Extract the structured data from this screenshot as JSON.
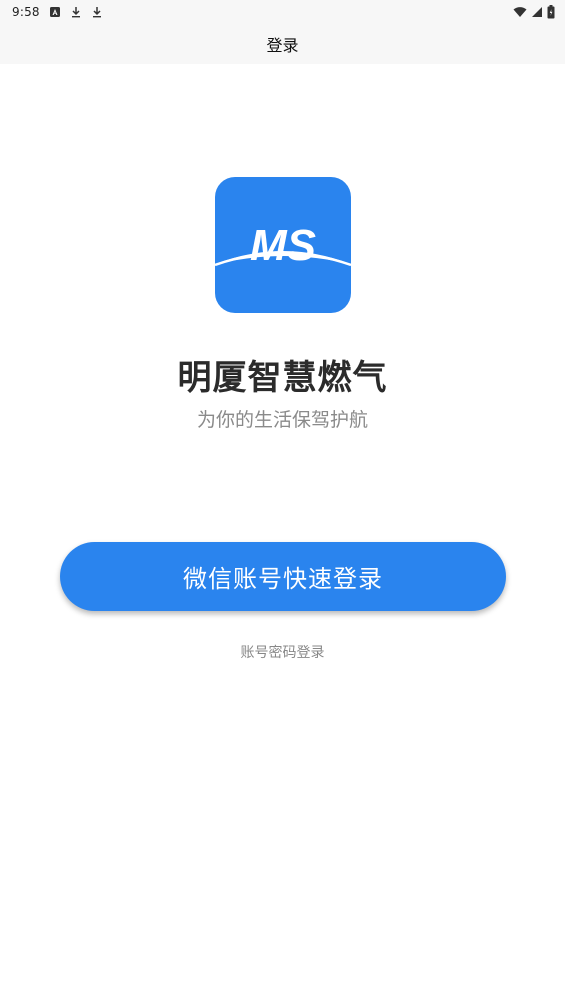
{
  "status_bar": {
    "time": "9:58",
    "left_icons": [
      "notification-a-icon",
      "download-icon",
      "download-icon"
    ],
    "right_icons": [
      "wifi-icon",
      "signal-icon",
      "battery-icon"
    ]
  },
  "navbar": {
    "title": "登录"
  },
  "logo": {
    "text": "MS",
    "color": "#2a84ee"
  },
  "app": {
    "name": "明厦智慧燃气",
    "slogan": "为你的生活保驾护航"
  },
  "login": {
    "wechat_label": "微信账号快速登录",
    "password_label": "账号密码登录",
    "accent": "#2a84ee"
  }
}
